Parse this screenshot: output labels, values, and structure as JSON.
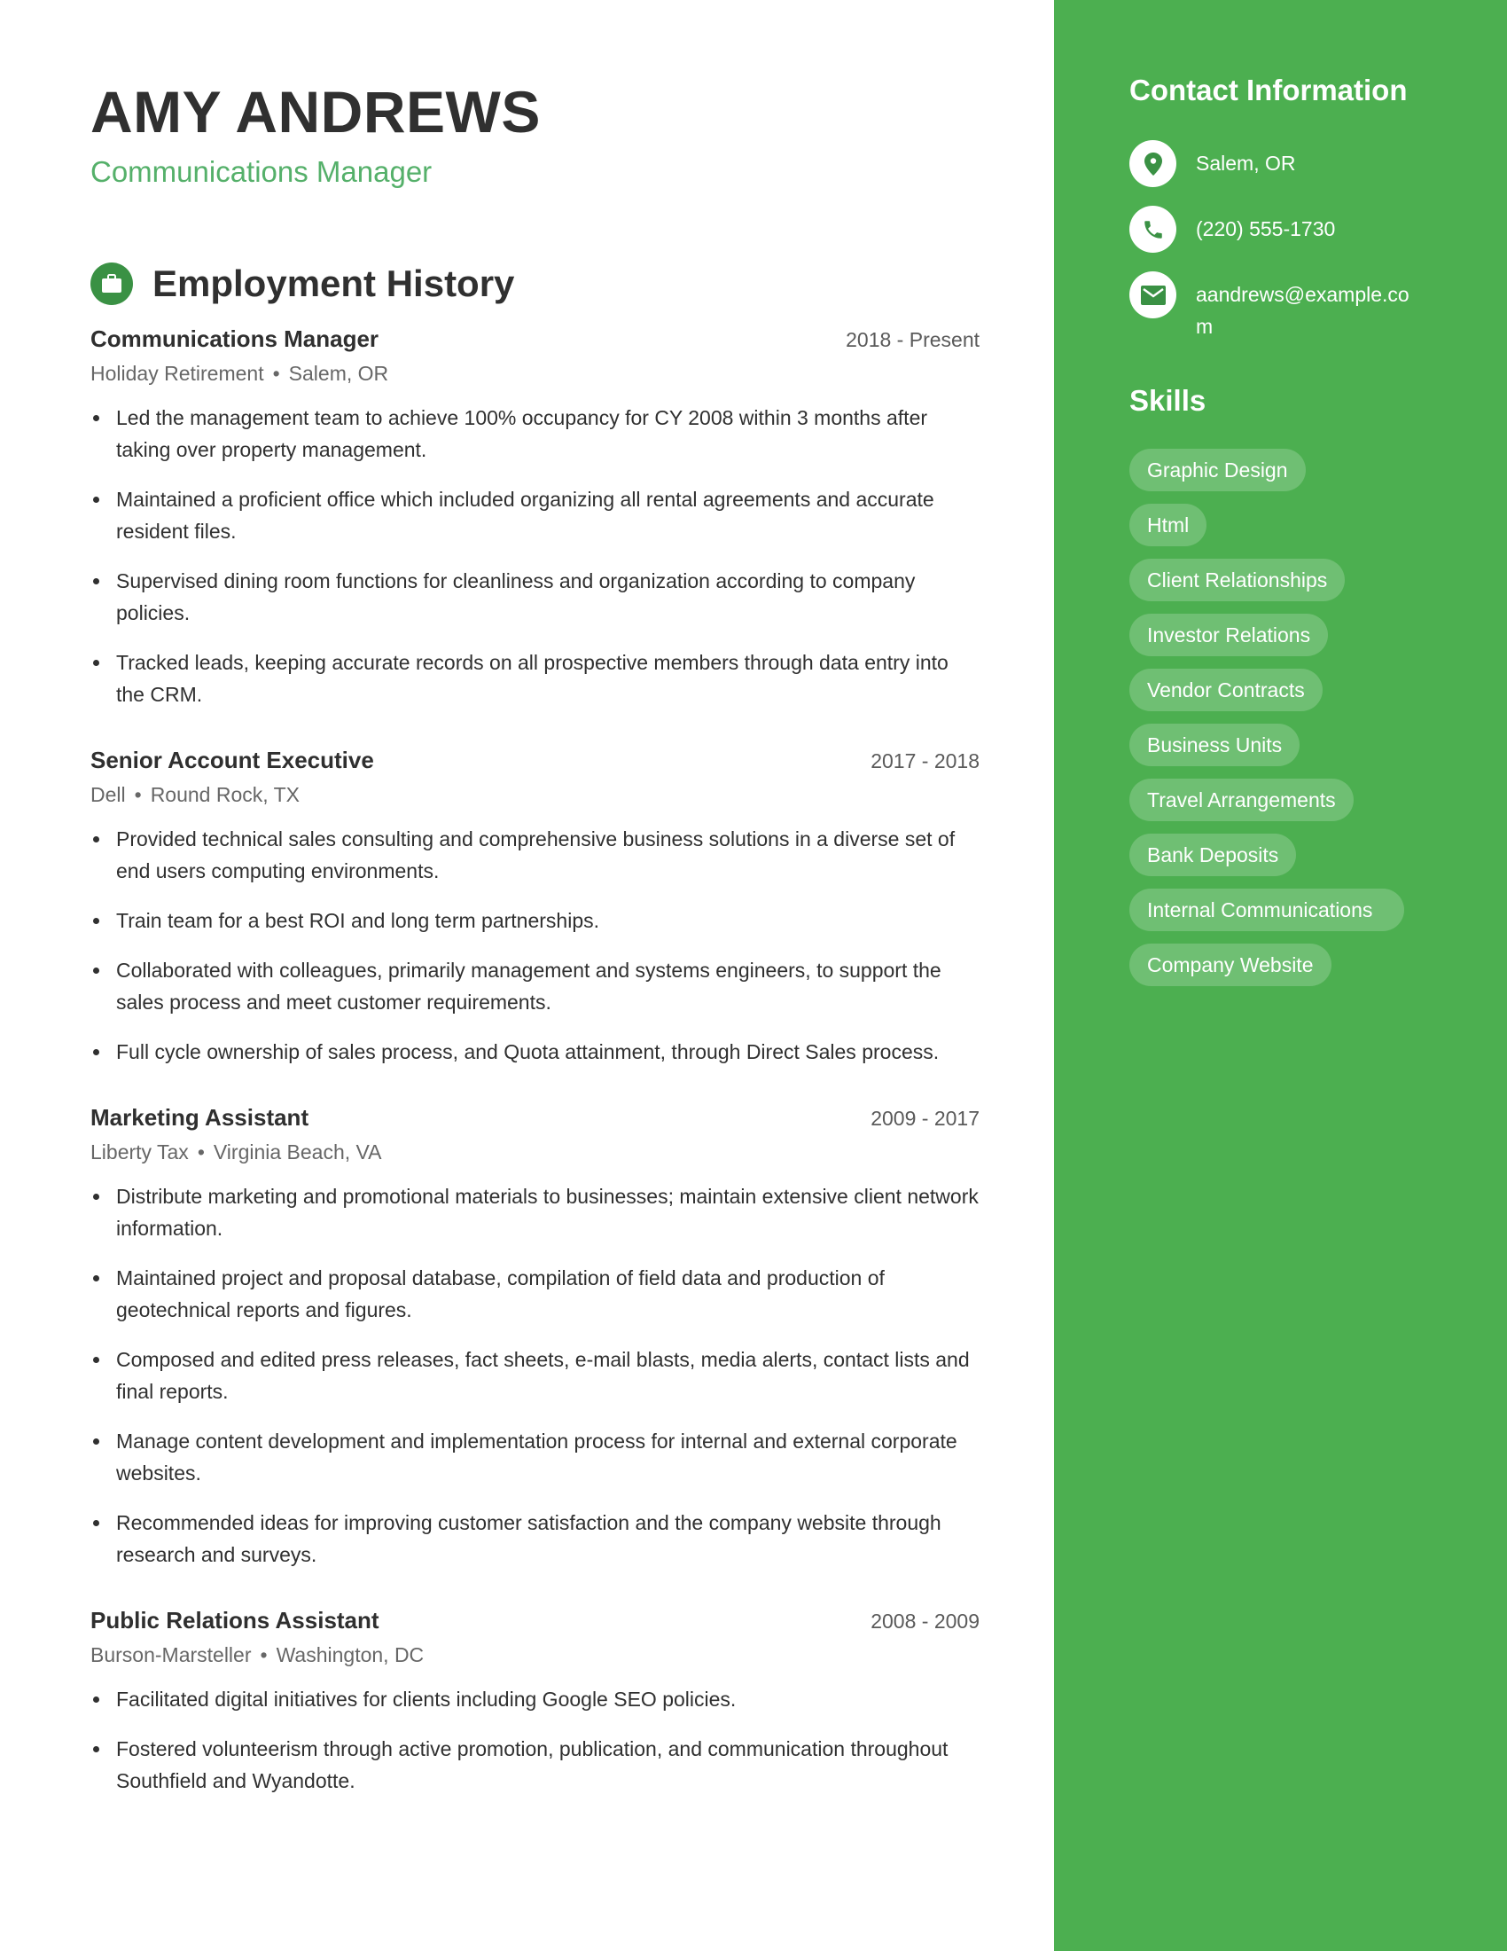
{
  "header": {
    "name": "AMY ANDREWS",
    "title": "Communications Manager"
  },
  "employment": {
    "section_title": "Employment History",
    "section_icon": "briefcase-icon",
    "jobs": [
      {
        "title": "Communications Manager",
        "dates": "2018 - Present",
        "company": "Holiday Retirement",
        "location": "Salem, OR",
        "bullets": [
          "Led the management team to achieve 100% occupancy for CY 2008 within 3 months after taking over property management.",
          "Maintained a proficient office which included organizing all rental agreements and accurate resident files.",
          "Supervised dining room functions for cleanliness and organization according to company policies.",
          "Tracked leads, keeping accurate records on all prospective members through data entry into the CRM."
        ]
      },
      {
        "title": "Senior Account Executive",
        "dates": "2017 - 2018",
        "company": "Dell",
        "location": "Round Rock, TX",
        "bullets": [
          "Provided technical sales consulting and comprehensive business solutions in a diverse set of end users computing environments.",
          "Train team for a best ROI and long term partnerships.",
          "Collaborated with colleagues, primarily management and systems engineers, to support the sales process and meet customer requirements.",
          "Full cycle ownership of sales process, and Quota attainment, through Direct Sales process."
        ]
      },
      {
        "title": "Marketing Assistant",
        "dates": "2009 - 2017",
        "company": "Liberty Tax",
        "location": "Virginia Beach, VA",
        "bullets": [
          "Distribute marketing and promotional materials to businesses; maintain extensive client network information.",
          "Maintained project and proposal database, compilation of field data and production of geotechnical reports and figures.",
          "Composed and edited press releases, fact sheets, e-mail blasts, media alerts, contact lists and final reports.",
          "Manage content development and implementation process for internal and external corporate websites.",
          "Recommended ideas for improving customer satisfaction and the company website through research and surveys."
        ]
      },
      {
        "title": "Public Relations Assistant",
        "dates": "2008 - 2009",
        "company": "Burson-Marsteller",
        "location": "Washington, DC",
        "bullets": [
          "Facilitated digital initiatives for clients including Google SEO policies.",
          "Fostered volunteerism through active promotion, publication, and communication throughout Southfield and Wyandotte."
        ]
      }
    ]
  },
  "sidebar": {
    "contact_title": "Contact Information",
    "contacts": [
      {
        "icon": "map-pin-icon",
        "text": "Salem, OR"
      },
      {
        "icon": "phone-icon",
        "text": "(220) 555-1730"
      },
      {
        "icon": "envelope-icon",
        "text": "aandrews@example.com"
      }
    ],
    "skills_title": "Skills",
    "skills": [
      "Graphic Design",
      "Html",
      "Client Relationships",
      "Investor Relations",
      "Vendor Contracts",
      "Business Units",
      "Travel Arrangements",
      "Bank Deposits",
      "Internal Communications",
      "Company Website"
    ]
  },
  "colors": {
    "sidebar_bg": "#4caf50",
    "accent_text": "#55b06a",
    "icon_green": "#3a9144"
  }
}
